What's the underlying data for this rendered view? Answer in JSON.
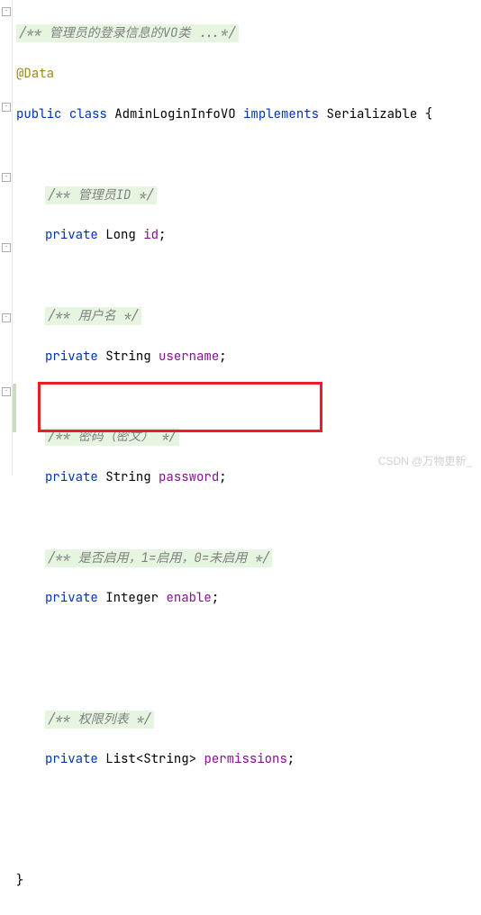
{
  "comments": {
    "classDoc": "/** 管理员的登录信息的VO类 ...*/",
    "idDoc": "/** 管理员ID */",
    "usernameDoc": "/** 用户名 */",
    "passwordDoc": "/** 密码（密文） */",
    "enableDoc": "/** 是否启用，1=启用，0=未启用 */",
    "permissionsDoc": "/** 权限列表 */"
  },
  "annotation": "@Data",
  "classDecl": {
    "kwPublic": "public",
    "kwClass": "class",
    "name": "AdminLoginInfoVO",
    "kwImplements": "implements",
    "iface": "Serializable",
    "open": "{",
    "close": "}"
  },
  "fields": {
    "kwPrivate": "private",
    "id": {
      "type": "Long",
      "name": "id"
    },
    "username": {
      "type": "String",
      "name": "username"
    },
    "password": {
      "type": "String",
      "name": "password"
    },
    "enable": {
      "type": "Integer",
      "name": "enable"
    },
    "permissions": {
      "typeOuter": "List",
      "typeInner": "String",
      "name": "permissions"
    }
  },
  "punct": {
    "semi": ";",
    "lt": "<",
    "gt": ">"
  },
  "watermark": "CSDN @万物更新_"
}
